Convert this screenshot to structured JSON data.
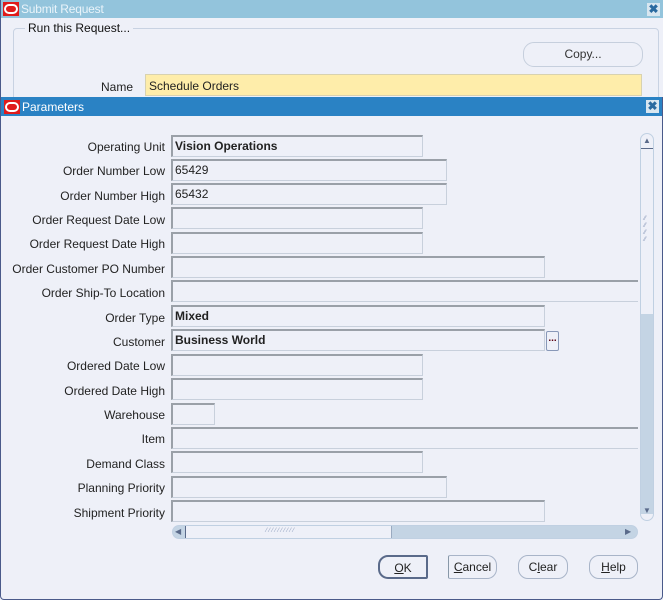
{
  "submit_request": {
    "title": "Submit Request",
    "group_label": "Run this Request...",
    "copy_button": "Copy...",
    "name_label": "Name",
    "name_value": "Schedule Orders"
  },
  "parameters": {
    "title": "Parameters",
    "fields": [
      {
        "label": "Operating Unit",
        "value": "Vision Operations"
      },
      {
        "label": "Order Number Low",
        "value": "65429"
      },
      {
        "label": "Order Number High",
        "value": "65432"
      },
      {
        "label": "Order Request Date Low",
        "value": ""
      },
      {
        "label": "Order Request Date High",
        "value": ""
      },
      {
        "label": "Order Customer PO Number",
        "value": ""
      },
      {
        "label": "Order Ship-To Location",
        "value": ""
      },
      {
        "label": "Order Type",
        "value": "Mixed"
      },
      {
        "label": "Customer",
        "value": "Business World"
      },
      {
        "label": "Ordered Date Low",
        "value": ""
      },
      {
        "label": "Ordered Date High",
        "value": ""
      },
      {
        "label": "Warehouse",
        "value": ""
      },
      {
        "label": "Item",
        "value": ""
      },
      {
        "label": "Demand Class",
        "value": ""
      },
      {
        "label": "Planning Priority",
        "value": ""
      },
      {
        "label": "Shipment Priority",
        "value": ""
      }
    ],
    "lov_button": "...",
    "buttons": {
      "ok_mnemonic": "O",
      "ok_rest": "K",
      "cancel_mnemonic": "C",
      "cancel_rest": "ancel",
      "clear_pre": "C",
      "clear_mnemonic": "l",
      "clear_rest": "ear",
      "help_mnemonic": "H",
      "help_rest": "elp"
    }
  },
  "icons": {
    "close": "✖",
    "scroll_up": "▲",
    "scroll_down": "▼",
    "scroll_left": "◀",
    "scroll_right": "▶"
  },
  "colors": {
    "title_active": "#2a82c4",
    "title_inactive": "#93c4dc",
    "name_field_bg": "#feedaa",
    "oracle_red": "#e01b1b"
  }
}
